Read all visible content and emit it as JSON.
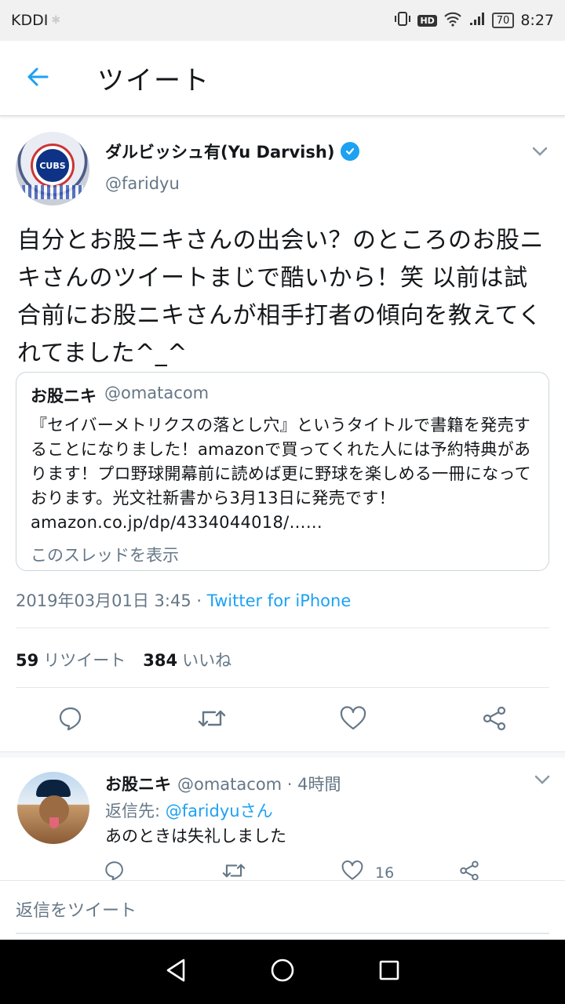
{
  "status_bar": {
    "carrier": "KDDI",
    "hd_label": "HD",
    "battery": "70",
    "time": "8:27"
  },
  "app_bar": {
    "title": "ツイート"
  },
  "tweet": {
    "author_name": "ダルビッシュ有(Yu Darvish)",
    "author_handle": "@faridyu",
    "avatar_text": "CUBS",
    "text": "自分とお股ニキさんの出会い？のところのお股ニキさんのツイートまじで酷いから！笑 以前は試合前にお股ニキさんが相手打者の傾向を教えてくれてました^_^",
    "quote": {
      "name": "お股ニキ",
      "handle": "@omatacom",
      "body": "『セイバーメトリクスの落とし穴』というタイトルで書籍を発売することになりました！amazonで買ってくれた人には予約特典があります！プロ野球開幕前に読めば更に野球を楽しめる一冊になっております。光文社新書から3月13日に発売です！ amazon.co.jp/dp/4334044018/……",
      "thread_link": "このスレッドを表示"
    },
    "timestamp": "2019年03月01日 3:45 · ",
    "source": "Twitter for iPhone",
    "retweet_count": "59",
    "retweet_label": "リツイート",
    "like_count": "384",
    "like_label": "いいね"
  },
  "reply": {
    "name": "お股ニキ",
    "handle": "@omatacom · 4時間",
    "reply_to_label": "返信先: ",
    "reply_to_mention": "@faridyuさん",
    "text": "あのときは失礼しました",
    "like_count": "16"
  },
  "compose": {
    "placeholder": "返信をツイート"
  },
  "colors": {
    "accent": "#1da1f2",
    "secondary_text": "#657786",
    "border": "#e1e8ed"
  },
  "icons": [
    "back-arrow-icon",
    "verified-badge-icon",
    "chevron-down-icon",
    "reply-icon",
    "retweet-icon",
    "like-icon",
    "share-icon",
    "nav-back-icon",
    "nav-home-icon",
    "nav-recents-icon"
  ]
}
